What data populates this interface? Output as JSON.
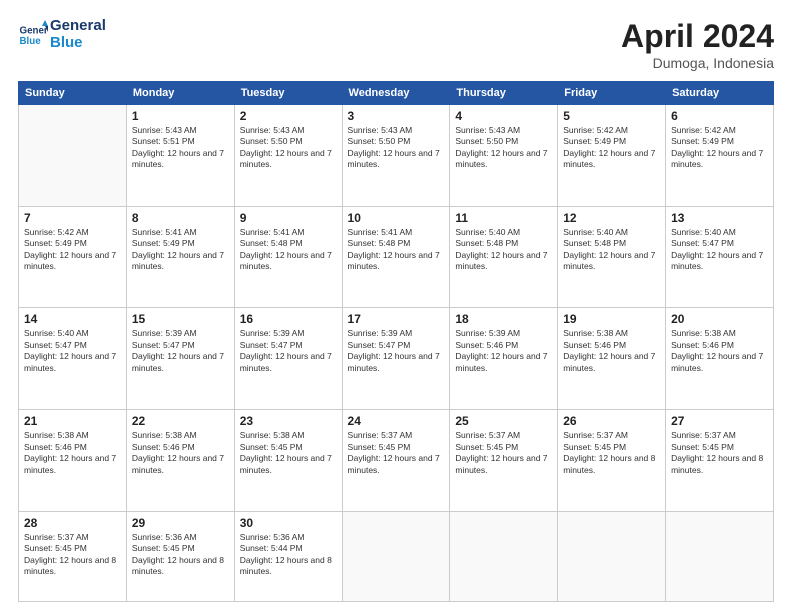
{
  "header": {
    "logo_line1": "General",
    "logo_line2": "Blue",
    "month": "April 2024",
    "location": "Dumoga, Indonesia"
  },
  "weekdays": [
    "Sunday",
    "Monday",
    "Tuesday",
    "Wednesday",
    "Thursday",
    "Friday",
    "Saturday"
  ],
  "weeks": [
    [
      {
        "day": "",
        "empty": true
      },
      {
        "day": "1",
        "sunrise": "Sunrise: 5:43 AM",
        "sunset": "Sunset: 5:51 PM",
        "daylight": "Daylight: 12 hours and 7 minutes."
      },
      {
        "day": "2",
        "sunrise": "Sunrise: 5:43 AM",
        "sunset": "Sunset: 5:50 PM",
        "daylight": "Daylight: 12 hours and 7 minutes."
      },
      {
        "day": "3",
        "sunrise": "Sunrise: 5:43 AM",
        "sunset": "Sunset: 5:50 PM",
        "daylight": "Daylight: 12 hours and 7 minutes."
      },
      {
        "day": "4",
        "sunrise": "Sunrise: 5:43 AM",
        "sunset": "Sunset: 5:50 PM",
        "daylight": "Daylight: 12 hours and 7 minutes."
      },
      {
        "day": "5",
        "sunrise": "Sunrise: 5:42 AM",
        "sunset": "Sunset: 5:49 PM",
        "daylight": "Daylight: 12 hours and 7 minutes."
      },
      {
        "day": "6",
        "sunrise": "Sunrise: 5:42 AM",
        "sunset": "Sunset: 5:49 PM",
        "daylight": "Daylight: 12 hours and 7 minutes."
      }
    ],
    [
      {
        "day": "7",
        "sunrise": "Sunrise: 5:42 AM",
        "sunset": "Sunset: 5:49 PM",
        "daylight": "Daylight: 12 hours and 7 minutes."
      },
      {
        "day": "8",
        "sunrise": "Sunrise: 5:41 AM",
        "sunset": "Sunset: 5:49 PM",
        "daylight": "Daylight: 12 hours and 7 minutes."
      },
      {
        "day": "9",
        "sunrise": "Sunrise: 5:41 AM",
        "sunset": "Sunset: 5:48 PM",
        "daylight": "Daylight: 12 hours and 7 minutes."
      },
      {
        "day": "10",
        "sunrise": "Sunrise: 5:41 AM",
        "sunset": "Sunset: 5:48 PM",
        "daylight": "Daylight: 12 hours and 7 minutes."
      },
      {
        "day": "11",
        "sunrise": "Sunrise: 5:40 AM",
        "sunset": "Sunset: 5:48 PM",
        "daylight": "Daylight: 12 hours and 7 minutes."
      },
      {
        "day": "12",
        "sunrise": "Sunrise: 5:40 AM",
        "sunset": "Sunset: 5:48 PM",
        "daylight": "Daylight: 12 hours and 7 minutes."
      },
      {
        "day": "13",
        "sunrise": "Sunrise: 5:40 AM",
        "sunset": "Sunset: 5:47 PM",
        "daylight": "Daylight: 12 hours and 7 minutes."
      }
    ],
    [
      {
        "day": "14",
        "sunrise": "Sunrise: 5:40 AM",
        "sunset": "Sunset: 5:47 PM",
        "daylight": "Daylight: 12 hours and 7 minutes."
      },
      {
        "day": "15",
        "sunrise": "Sunrise: 5:39 AM",
        "sunset": "Sunset: 5:47 PM",
        "daylight": "Daylight: 12 hours and 7 minutes."
      },
      {
        "day": "16",
        "sunrise": "Sunrise: 5:39 AM",
        "sunset": "Sunset: 5:47 PM",
        "daylight": "Daylight: 12 hours and 7 minutes."
      },
      {
        "day": "17",
        "sunrise": "Sunrise: 5:39 AM",
        "sunset": "Sunset: 5:47 PM",
        "daylight": "Daylight: 12 hours and 7 minutes."
      },
      {
        "day": "18",
        "sunrise": "Sunrise: 5:39 AM",
        "sunset": "Sunset: 5:46 PM",
        "daylight": "Daylight: 12 hours and 7 minutes."
      },
      {
        "day": "19",
        "sunrise": "Sunrise: 5:38 AM",
        "sunset": "Sunset: 5:46 PM",
        "daylight": "Daylight: 12 hours and 7 minutes."
      },
      {
        "day": "20",
        "sunrise": "Sunrise: 5:38 AM",
        "sunset": "Sunset: 5:46 PM",
        "daylight": "Daylight: 12 hours and 7 minutes."
      }
    ],
    [
      {
        "day": "21",
        "sunrise": "Sunrise: 5:38 AM",
        "sunset": "Sunset: 5:46 PM",
        "daylight": "Daylight: 12 hours and 7 minutes."
      },
      {
        "day": "22",
        "sunrise": "Sunrise: 5:38 AM",
        "sunset": "Sunset: 5:46 PM",
        "daylight": "Daylight: 12 hours and 7 minutes."
      },
      {
        "day": "23",
        "sunrise": "Sunrise: 5:38 AM",
        "sunset": "Sunset: 5:45 PM",
        "daylight": "Daylight: 12 hours and 7 minutes."
      },
      {
        "day": "24",
        "sunrise": "Sunrise: 5:37 AM",
        "sunset": "Sunset: 5:45 PM",
        "daylight": "Daylight: 12 hours and 7 minutes."
      },
      {
        "day": "25",
        "sunrise": "Sunrise: 5:37 AM",
        "sunset": "Sunset: 5:45 PM",
        "daylight": "Daylight: 12 hours and 7 minutes."
      },
      {
        "day": "26",
        "sunrise": "Sunrise: 5:37 AM",
        "sunset": "Sunset: 5:45 PM",
        "daylight": "Daylight: 12 hours and 8 minutes."
      },
      {
        "day": "27",
        "sunrise": "Sunrise: 5:37 AM",
        "sunset": "Sunset: 5:45 PM",
        "daylight": "Daylight: 12 hours and 8 minutes."
      }
    ],
    [
      {
        "day": "28",
        "sunrise": "Sunrise: 5:37 AM",
        "sunset": "Sunset: 5:45 PM",
        "daylight": "Daylight: 12 hours and 8 minutes."
      },
      {
        "day": "29",
        "sunrise": "Sunrise: 5:36 AM",
        "sunset": "Sunset: 5:45 PM",
        "daylight": "Daylight: 12 hours and 8 minutes."
      },
      {
        "day": "30",
        "sunrise": "Sunrise: 5:36 AM",
        "sunset": "Sunset: 5:44 PM",
        "daylight": "Daylight: 12 hours and 8 minutes."
      },
      {
        "day": "",
        "empty": true
      },
      {
        "day": "",
        "empty": true
      },
      {
        "day": "",
        "empty": true
      },
      {
        "day": "",
        "empty": true
      }
    ]
  ]
}
